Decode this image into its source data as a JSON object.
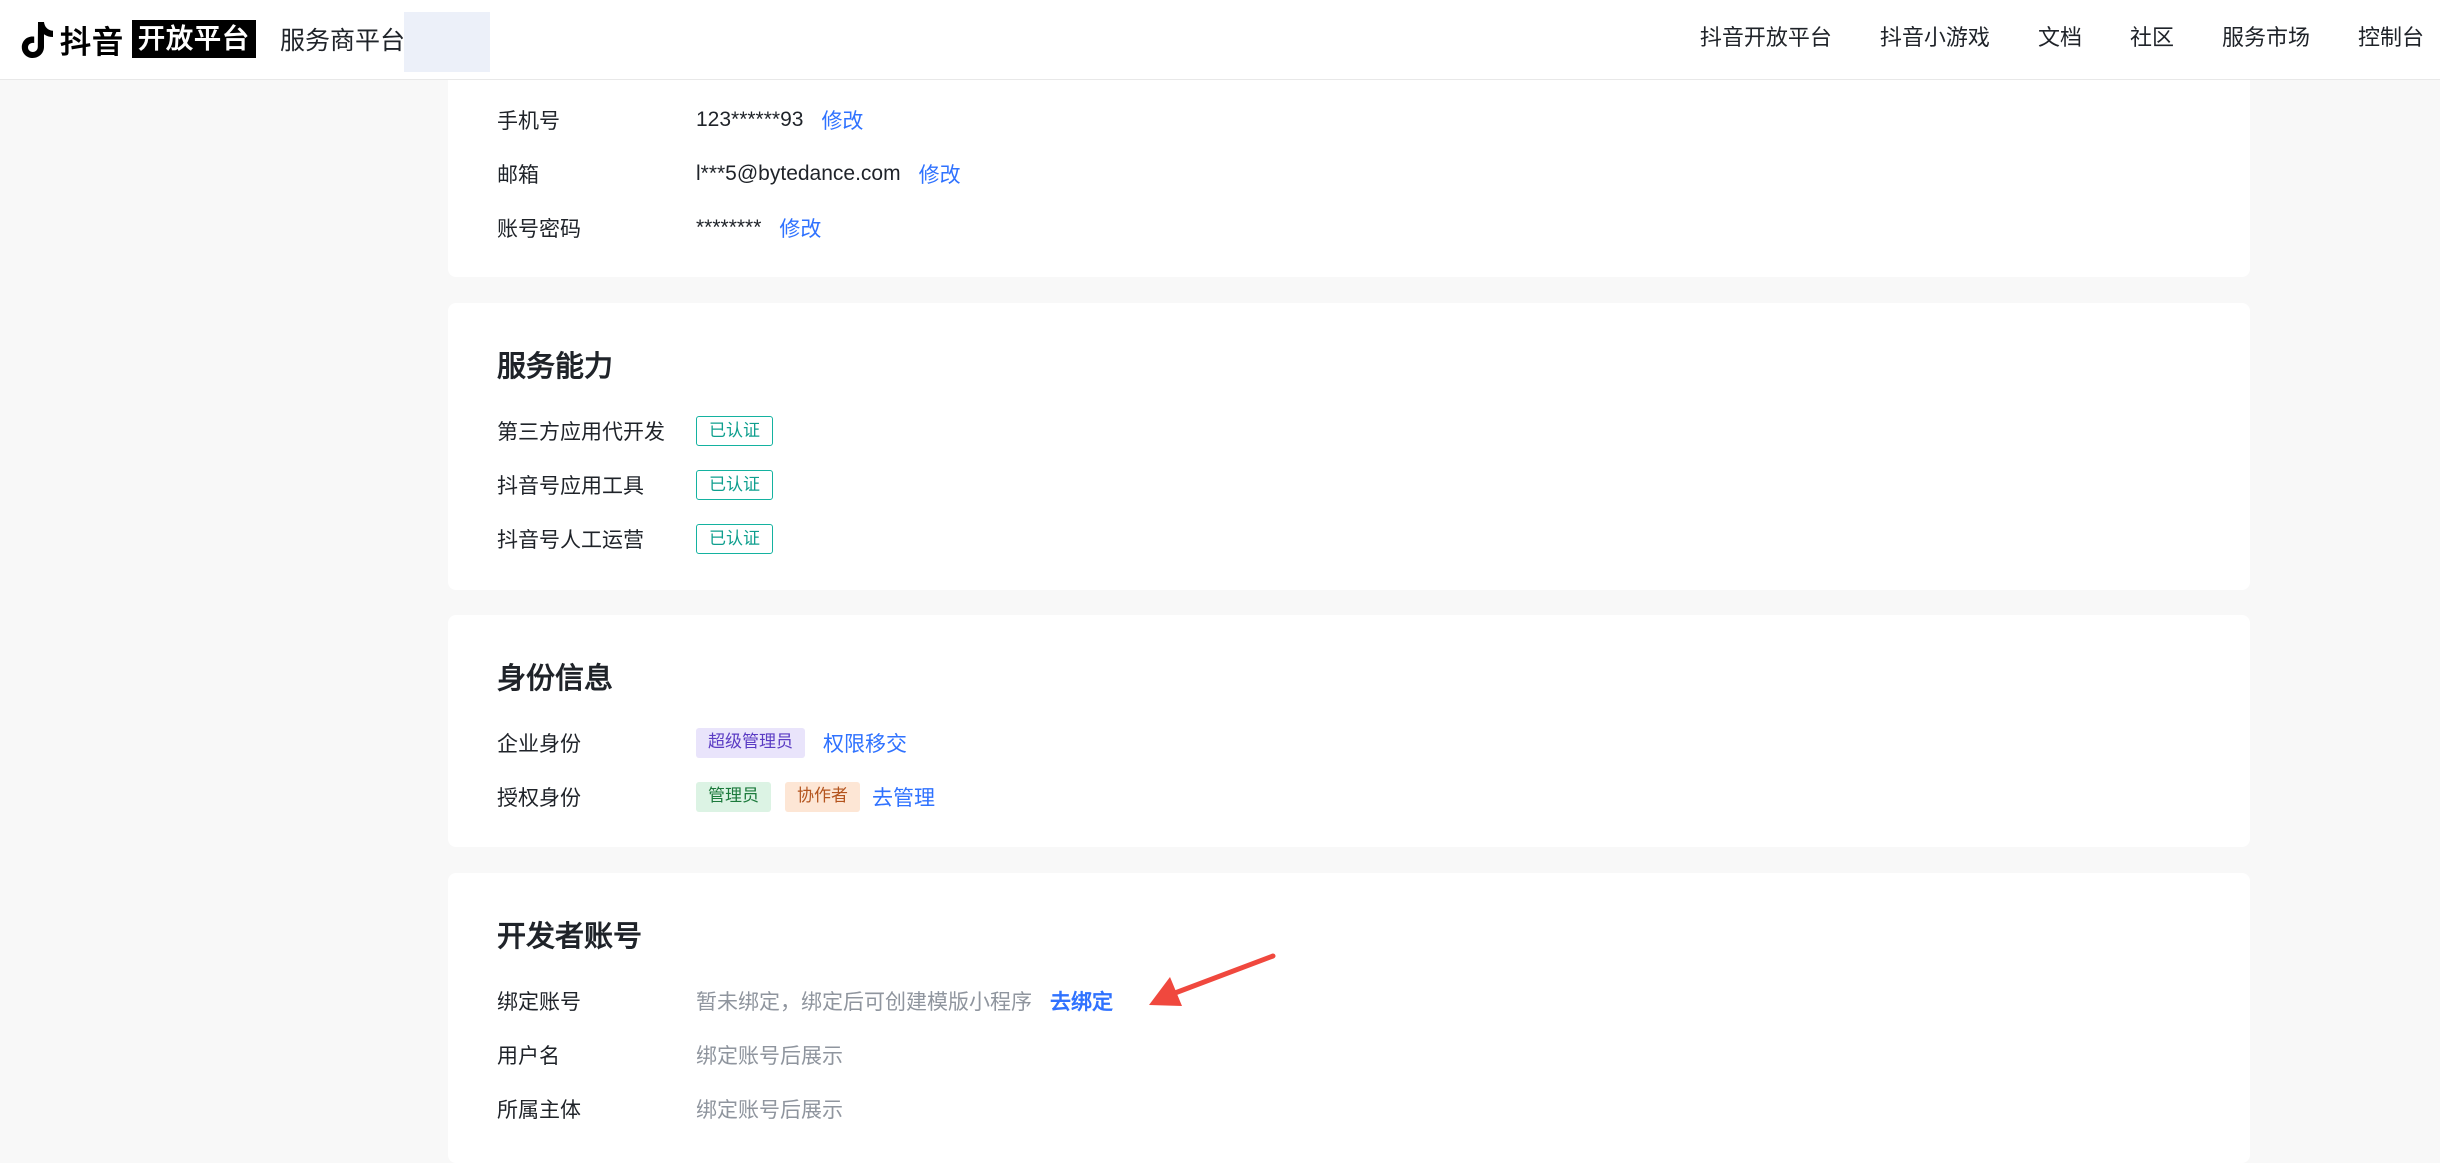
{
  "header": {
    "brand_name": "抖音",
    "brand_badge": "开放平台",
    "brand_sub": "服务商平台",
    "nav": [
      "抖音开放平台",
      "抖音小游戏",
      "文档",
      "社区",
      "服务市场",
      "控制台"
    ]
  },
  "account": {
    "phone_label": "手机号",
    "phone_value": "123******93",
    "phone_action": "修改",
    "email_label": "邮箱",
    "email_value": "l***5@bytedance.com",
    "email_action": "修改",
    "password_label": "账号密码",
    "password_value": "********",
    "password_action": "修改"
  },
  "service": {
    "title": "服务能力",
    "items": [
      {
        "label": "第三方应用代开发",
        "status": "已认证"
      },
      {
        "label": "抖音号应用工具",
        "status": "已认证"
      },
      {
        "label": "抖音号人工运营",
        "status": "已认证"
      }
    ]
  },
  "identity": {
    "title": "身份信息",
    "enterprise_label": "企业身份",
    "enterprise_tag": "超级管理员",
    "enterprise_action": "权限移交",
    "auth_label": "授权身份",
    "auth_tags": [
      "管理员",
      "协作者"
    ],
    "auth_action": "去管理"
  },
  "developer": {
    "title": "开发者账号",
    "bind_label": "绑定账号",
    "bind_value": "暂未绑定，绑定后可创建模版小程序",
    "bind_action": "去绑定",
    "username_label": "用户名",
    "username_value": "绑定账号后展示",
    "entity_label": "所属主体",
    "entity_value": "绑定账号后展示"
  },
  "colors": {
    "link": "#2f72ff",
    "cert": "#14b2a0",
    "annotation_arrow": "#f0483e"
  },
  "icons": {
    "logo": "tiktok-note-icon",
    "annotation": "red-arrow-icon"
  }
}
